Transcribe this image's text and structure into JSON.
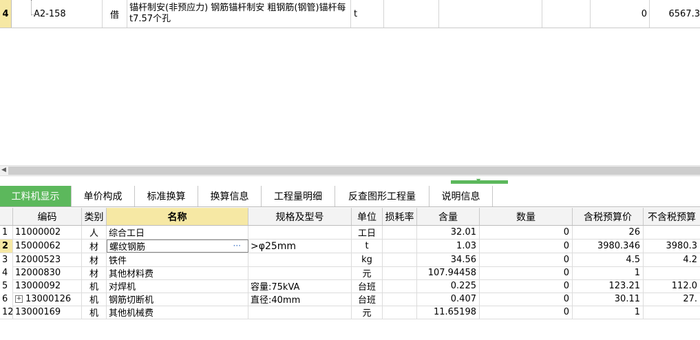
{
  "top_row": {
    "row_number": "4",
    "code": "A2-158",
    "type": "借",
    "name": "锚杆制安(非预应力) 钢筋锚杆制安 粗钢筋(钢管)锚杆每t7.57个孔",
    "unit": "t",
    "value1": "0",
    "value2": "6567.3"
  },
  "tabs": [
    {
      "label": "工料机显示",
      "active": true
    },
    {
      "label": "单价构成"
    },
    {
      "label": "标准换算"
    },
    {
      "label": "换算信息"
    },
    {
      "label": "工程量明细"
    },
    {
      "label": "反查图形工程量"
    },
    {
      "label": "说明信息"
    }
  ],
  "columns": [
    "编码",
    "类别",
    "名称",
    "规格及型号",
    "单位",
    "损耗率",
    "含量",
    "数量",
    "含税预算价",
    "不含税预算"
  ],
  "rows": [
    {
      "rn": "1",
      "code": "11000002",
      "type": "人",
      "name": "综合工日",
      "spec": "",
      "unit": "工日",
      "loss": "",
      "content": "32.01",
      "qty": "0",
      "price_tax": "26",
      "price_notax": ""
    },
    {
      "rn": "2",
      "code": "15000062",
      "type": "材",
      "name": "螺纹钢筋",
      "spec": ">φ25mm",
      "unit": "t",
      "loss": "",
      "content": "1.03",
      "qty": "0",
      "price_tax": "3980.346",
      "price_notax": "3980.3"
    },
    {
      "rn": "3",
      "code": "12000523",
      "type": "材",
      "name": "铁件",
      "spec": "",
      "unit": "kg",
      "loss": "",
      "content": "34.56",
      "qty": "0",
      "price_tax": "4.5",
      "price_notax": "4.2"
    },
    {
      "rn": "4",
      "code": "12000830",
      "type": "材",
      "name": "其他材料费",
      "spec": "",
      "unit": "元",
      "loss": "",
      "content": "107.94458",
      "qty": "0",
      "price_tax": "1",
      "price_notax": ""
    },
    {
      "rn": "5",
      "code": "13000092",
      "type": "机",
      "name": "对焊机",
      "spec": "容量:75kVA",
      "unit": "台班",
      "loss": "",
      "content": "0.225",
      "qty": "0",
      "price_tax": "123.21",
      "price_notax": "112.0"
    },
    {
      "rn": "6",
      "code": "13000126",
      "type": "机",
      "name": "钢筋切断机",
      "spec": "直径:40mm",
      "unit": "台班",
      "loss": "",
      "content": "0.407",
      "qty": "0",
      "price_tax": "30.11",
      "price_notax": "27."
    },
    {
      "rn": "12",
      "code": "13000169",
      "type": "机",
      "name": "其他机械费",
      "spec": "",
      "unit": "元",
      "loss": "",
      "content": "11.65198",
      "qty": "0",
      "price_tax": "1",
      "price_notax": ""
    }
  ],
  "colors": {
    "accent": "#5cb85c",
    "selection": "#f6e8a4"
  }
}
